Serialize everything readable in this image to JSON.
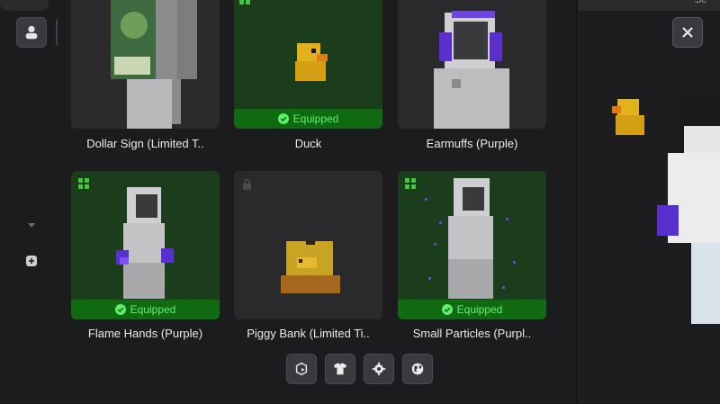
{
  "rail": {
    "profile_icon": "person-icon",
    "link_icon": "link-icon",
    "collapse_icon": "caret-down-icon",
    "add_icon": "plus-icon"
  },
  "cards": [
    {
      "name": "Dollar Sign (Limited T..",
      "equipped": false,
      "badge": ""
    },
    {
      "name": "Duck",
      "equipped": true,
      "badge": "Equipped"
    },
    {
      "name": "Earmuffs (Purple)",
      "equipped": false,
      "badge": ""
    },
    {
      "name": "Flame Hands (Purple)",
      "equipped": true,
      "badge": "Equipped"
    },
    {
      "name": "Piggy Bank (Limited Ti..",
      "equipped": false,
      "badge": ""
    },
    {
      "name": "Small Particles (Purpl..",
      "equipped": true,
      "badge": "Equipped"
    }
  ],
  "bottom_nav": [
    "emote-icon",
    "shirt-icon",
    "gear-icon",
    "globe-icon"
  ],
  "preview": {
    "close_icon": "close-icon",
    "top_text": "Sc"
  },
  "colors": {
    "equipped_bg": "#1b3d1c",
    "equipped_bar": "#0f6a12",
    "equipped_text": "#5ff06a"
  }
}
